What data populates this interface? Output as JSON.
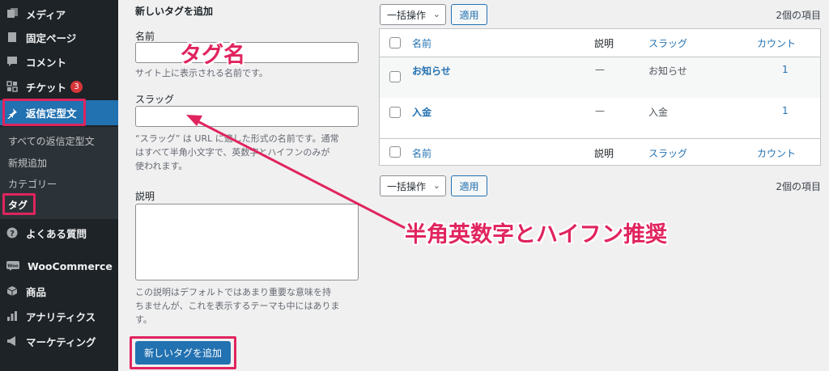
{
  "sidebar": {
    "items": [
      {
        "label": "メディア",
        "icon": "media-icon"
      },
      {
        "label": "固定ページ",
        "icon": "page-icon"
      },
      {
        "label": "コメント",
        "icon": "comment-icon"
      },
      {
        "label": "チケット",
        "icon": "ticket-icon",
        "badge": "3"
      },
      {
        "label": "返信定型文",
        "icon": "pin-icon"
      },
      {
        "label": "よくある質問",
        "icon": "question-icon"
      },
      {
        "label": "WooCommerce",
        "icon": "woocommerce-icon",
        "icon_text": "Woo"
      },
      {
        "label": "商品",
        "icon": "product-icon"
      },
      {
        "label": "アナリティクス",
        "icon": "analytics-icon"
      },
      {
        "label": "マーケティング",
        "icon": "marketing-icon"
      }
    ],
    "submenu": [
      "すべての返信定型文",
      "新規追加",
      "カテゴリー",
      "タグ"
    ]
  },
  "form": {
    "title": "新しいタグを追加",
    "name_label": "名前",
    "name_help": "サイト上に表示される名前です。",
    "slug_label": "スラッグ",
    "slug_help_lines": [
      "“スラッグ” は URL に適した形式の名前です。通常",
      "はすべて半角小文字で、英数字とハイフンのみが",
      "使われます。"
    ],
    "description_label": "説明",
    "description_help_lines": [
      "この説明はデフォルトではあまり重要な意味を持",
      "ちませんが、これを表示するテーマも中にはありま",
      "す。"
    ],
    "submit_label": "新しいタグを追加"
  },
  "table": {
    "bulk_action_label": "一括操作",
    "apply_label": "適用",
    "item_count": "2個の項目",
    "headers": {
      "name": "名前",
      "description": "説明",
      "slug": "スラッグ",
      "count": "カウント"
    },
    "rows": [
      {
        "name": "お知らせ",
        "description": "—",
        "slug": "お知らせ",
        "count": "1"
      },
      {
        "name": "入金",
        "description": "—",
        "slug": "入金",
        "count": "1"
      }
    ]
  },
  "annotations": {
    "tag_name": "タグ名",
    "slug_note": "半角英数字とハイフン推奨",
    "color": "#e0245e"
  },
  "colors": {
    "accent": "#2271b1",
    "sidebar_bg": "#1d2327",
    "highlight": "#e0245e"
  }
}
